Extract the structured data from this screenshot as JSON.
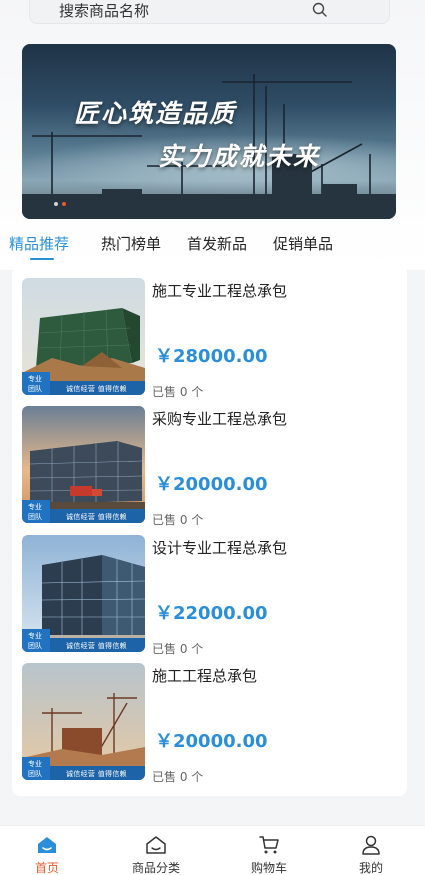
{
  "search": {
    "placeholder": "搜索商品名称"
  },
  "banner": {
    "line1": "匠心筑造品质",
    "line2": "实力成就未来",
    "slide_count": 2,
    "active_slide": 2
  },
  "tabs": [
    {
      "label": "精品推荐",
      "active": true
    },
    {
      "label": "热门榜单",
      "active": false
    },
    {
      "label": "首发新品",
      "active": false
    },
    {
      "label": "促销单品",
      "active": false
    }
  ],
  "thumb_tags": {
    "left": "专业\n团队",
    "right": "诚信经营  值得信赖"
  },
  "products": [
    {
      "title": "施工专业工程总承包",
      "price": "￥28000.00",
      "sold": "已售 0 个"
    },
    {
      "title": "采购专业工程总承包",
      "price": "￥20000.00",
      "sold": "已售 0 个"
    },
    {
      "title": "设计专业工程总承包",
      "price": "￥22000.00",
      "sold": "已售 0 个"
    },
    {
      "title": "施工工程总承包",
      "price": "￥20000.00",
      "sold": "已售 0 个"
    }
  ],
  "bottom_nav": [
    {
      "label": "首页",
      "icon": "home-icon",
      "active": true
    },
    {
      "label": "商品分类",
      "icon": "category-icon",
      "active": false
    },
    {
      "label": "购物车",
      "icon": "cart-icon",
      "active": false
    },
    {
      "label": "我的",
      "icon": "user-icon",
      "active": false
    }
  ],
  "colors": {
    "accent": "#2a8fd8",
    "active_nav": "#e45b2c",
    "tag_blue": "#1c63a8"
  }
}
